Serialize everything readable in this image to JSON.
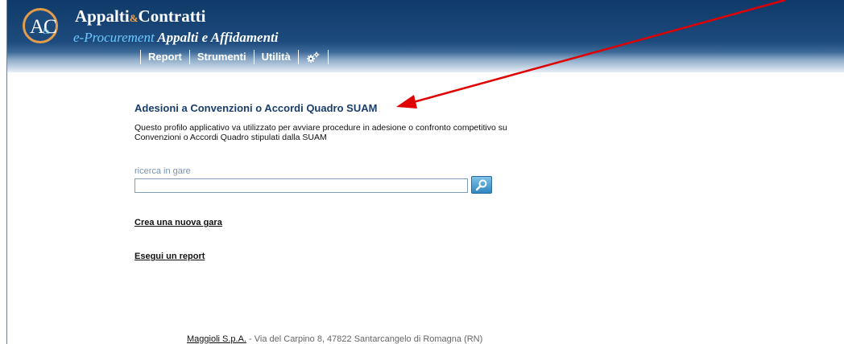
{
  "header": {
    "logo_text": "AC",
    "logo_amp": "&",
    "title_part1": "Appalti",
    "title_amp": "&",
    "title_part2": "Contratti",
    "subtitle_eproc": "e-Procurement",
    "subtitle_rest": " Appalti e Affidamenti",
    "menu": [
      {
        "label": "Report"
      },
      {
        "label": "Strumenti"
      },
      {
        "label": "Utilità"
      },
      {
        "icon": "gears-icon"
      }
    ]
  },
  "main": {
    "title": "Adesioni a Convenzioni o Accordi Quadro SUAM",
    "description": "Questo profilo applicativo va utilizzato per avviare procedure in adesione o confronto competitivo su Convenzioni o Accordi Quadro stipulati dalla SUAM",
    "search": {
      "label": "ricerca in gare",
      "value": "",
      "placeholder": "",
      "button_icon": "search-icon"
    },
    "links": {
      "create": "Crea una nuova gara",
      "report": "Esegui un report"
    }
  },
  "footer": {
    "company": "Maggioli S.p.A.",
    "address": " - Via del Carpino 8, 47822 Santarcangelo di Romagna (RN)"
  },
  "annotation": {
    "arrow_color": "#e00000",
    "icon": "arrow-icon"
  },
  "colors": {
    "header_bg": "#0f3a69",
    "title_color": "#1a3d6d",
    "logo_ring": "#e29c4b",
    "eproc_color": "#6ec8ff"
  }
}
